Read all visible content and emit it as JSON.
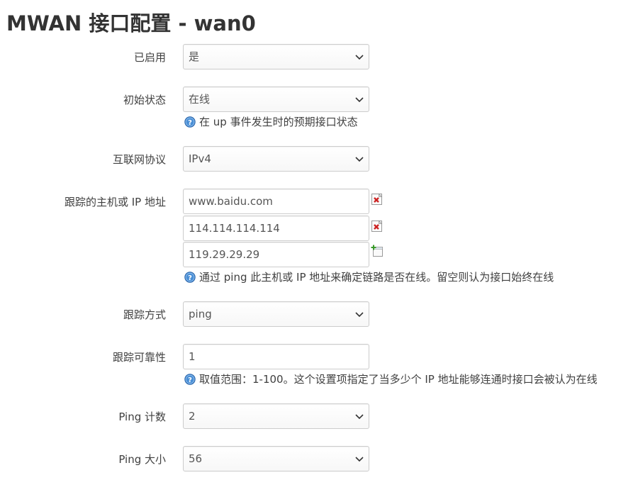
{
  "title": "MWAN 接口配置 - wan0",
  "fields": {
    "enabled": {
      "label": "已启用",
      "value": "是"
    },
    "initial_state": {
      "label": "初始状态",
      "value": "在线",
      "help": "在 up 事件发生时的预期接口状态"
    },
    "family": {
      "label": "互联网协议",
      "value": "IPv4"
    },
    "track_ip": {
      "label": "跟踪的主机或 IP 地址",
      "hosts": [
        "www.baidu.com",
        "114.114.114.114",
        "119.29.29.29"
      ],
      "help": "通过 ping 此主机或 IP 地址来确定链路是否在线。留空则认为接口始终在线"
    },
    "track_method": {
      "label": "跟踪方式",
      "value": "ping"
    },
    "reliability": {
      "label": "跟踪可靠性",
      "value": "1",
      "help": "取值范围：1-100。这个设置项指定了当多少个 IP 地址能够连通时接口会被认为在线"
    },
    "count": {
      "label": "Ping 计数",
      "value": "2"
    },
    "size": {
      "label": "Ping 大小",
      "value": "56"
    }
  },
  "icons": {
    "help": "help-question-icon",
    "remove": "remove-entry-icon",
    "add": "add-entry-icon"
  },
  "colors": {
    "help_blue": "#3a7fc8",
    "remove_red": "#cc2222",
    "add_green": "#3a9a2a"
  }
}
